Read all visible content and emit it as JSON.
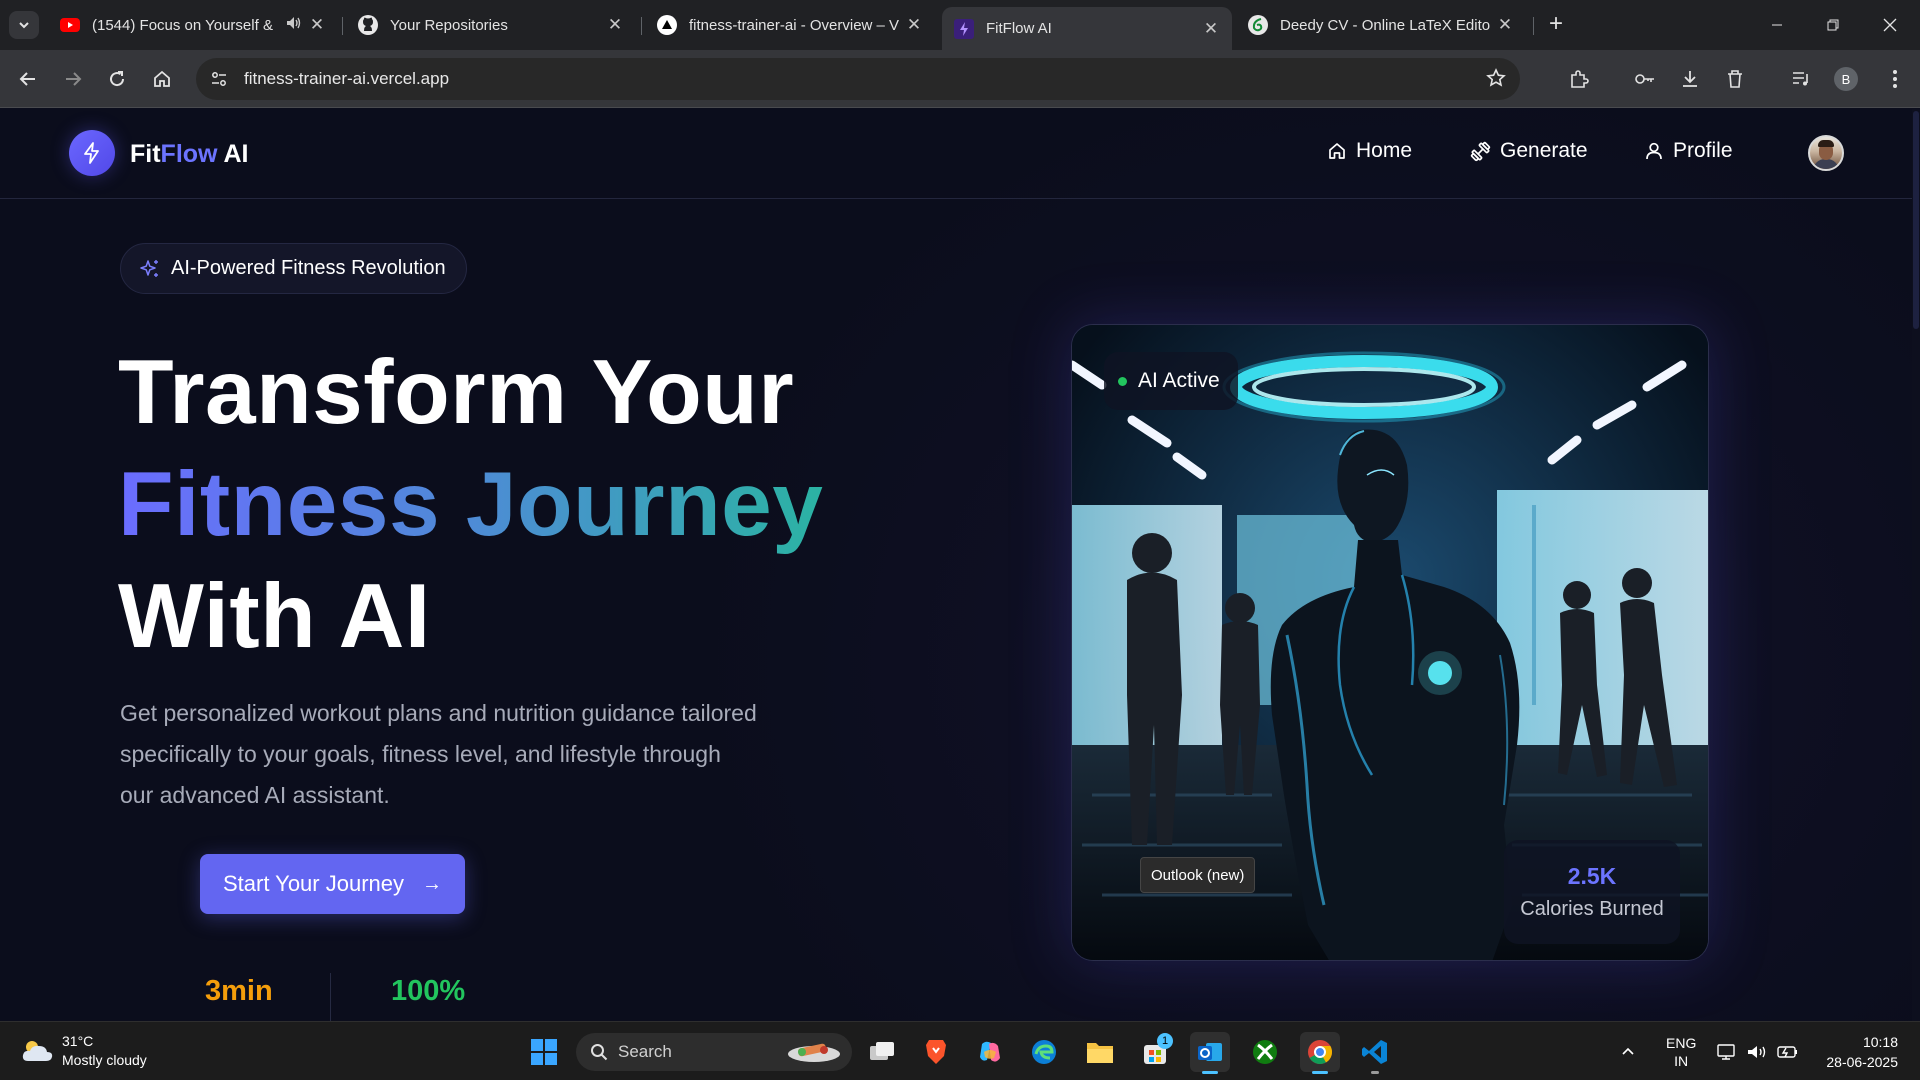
{
  "browser": {
    "tabs": [
      {
        "title": "(1544) Focus on Yourself & ",
        "active": false,
        "icon": "youtube-icon"
      },
      {
        "title": "Your Repositories",
        "active": false,
        "icon": "github-icon"
      },
      {
        "title": "fitness-trainer-ai - Overview – V",
        "active": false,
        "icon": "vercel-icon"
      },
      {
        "title": "FitFlow AI",
        "active": true,
        "icon": "fitflow-icon"
      },
      {
        "title": "Deedy CV - Online LaTeX Editor",
        "active": false,
        "icon": "overleaf-icon"
      }
    ],
    "url": "fitness-trainer-ai.vercel.app",
    "profile_initial": "B"
  },
  "site": {
    "logo": {
      "part1": "Fit",
      "part2": "Flow",
      "part3": " AI"
    },
    "nav": {
      "home": "Home",
      "generate": "Generate",
      "profile": "Profile"
    },
    "badge": "AI-Powered Fitness Revolution",
    "hero": {
      "line1": "Transform Your",
      "line2": "Fitness Journey",
      "line3": "With AI",
      "description": "Get personalized workout plans and nutrition guidance tailored specifically to your goals, fitness level, and lifestyle through our advanced AI assistant.",
      "cta": "Start Your Journey",
      "cta_arrow": "→"
    },
    "stats": [
      {
        "value": "3min",
        "color": "#f59e0b"
      },
      {
        "value": "100%",
        "color": "#22c55e"
      }
    ],
    "image": {
      "status": "AI Active",
      "calories_value": "2.5K",
      "calories_label": "Calories Burned"
    }
  },
  "tooltip": "Outlook (new)",
  "taskbar": {
    "weather_temp": "31°C",
    "weather_desc": "Mostly cloudy",
    "search": "Search",
    "lang_top": "ENG",
    "lang_bottom": "IN",
    "time": "10:18",
    "date": "28-06-2025",
    "store_badge": "1"
  },
  "colors": {
    "accent": "#6366f1",
    "page_bg": "#0b0d1c",
    "ai_dot": "#22c55e"
  }
}
